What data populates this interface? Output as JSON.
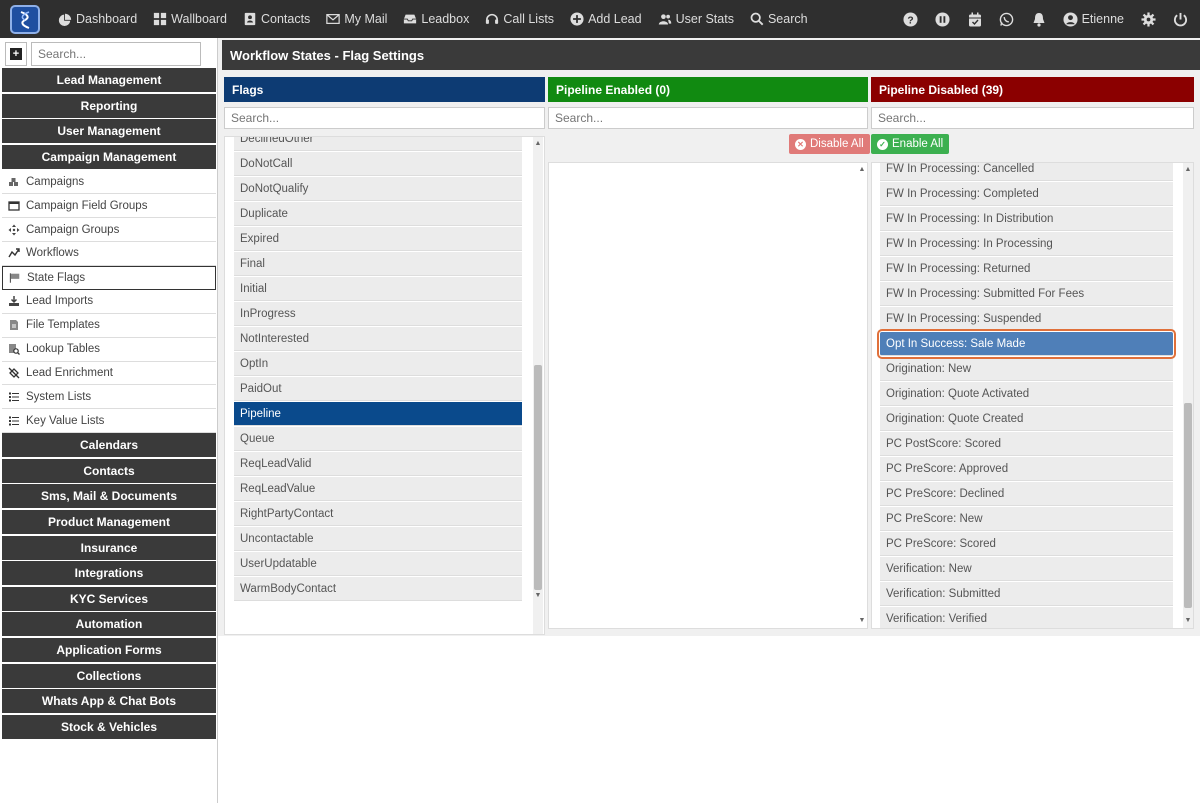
{
  "nav": {
    "items": [
      {
        "label": "Dashboard",
        "icon": "dashboard-icon"
      },
      {
        "label": "Wallboard",
        "icon": "grid-icon"
      },
      {
        "label": "Contacts",
        "icon": "contacts-icon"
      },
      {
        "label": "My Mail",
        "icon": "mail-icon"
      },
      {
        "label": "Leadbox",
        "icon": "inbox-icon"
      },
      {
        "label": "Call Lists",
        "icon": "headset-icon"
      },
      {
        "label": "Add Lead",
        "icon": "plus-circle-icon"
      },
      {
        "label": "User Stats",
        "icon": "users-icon"
      },
      {
        "label": "Search",
        "icon": "search-icon"
      }
    ],
    "user": "Etienne"
  },
  "sidebar": {
    "search_placeholder": "Search...",
    "sections_top": [
      "Lead Management",
      "Reporting",
      "User Management",
      "Campaign Management"
    ],
    "sub_items": [
      {
        "label": "Campaigns",
        "icon": "campaigns-icon"
      },
      {
        "label": "Campaign Field Groups",
        "icon": "window-icon"
      },
      {
        "label": "Campaign Groups",
        "icon": "cross-arrows-icon"
      },
      {
        "label": "Workflows",
        "icon": "workflow-icon"
      },
      {
        "label": "State Flags",
        "icon": "flag-icon"
      },
      {
        "label": "Lead Imports",
        "icon": "import-icon"
      },
      {
        "label": "File Templates",
        "icon": "file-icon"
      },
      {
        "label": "Lookup Tables",
        "icon": "lookup-icon"
      },
      {
        "label": "Lead Enrichment",
        "icon": "enrich-icon"
      },
      {
        "label": "System Lists",
        "icon": "list-icon"
      },
      {
        "label": "Key Value Lists",
        "icon": "list-icon"
      }
    ],
    "active_sub": "State Flags",
    "sections_bottom": [
      "Calendars",
      "Contacts",
      "Sms, Mail & Documents",
      "Product Management",
      "Insurance",
      "Integrations",
      "KYC Services",
      "Automation",
      "Application Forms",
      "Collections",
      "Whats App & Chat Bots",
      "Stock & Vehicles"
    ]
  },
  "page": {
    "title": "Workflow States - Flag Settings"
  },
  "flags": {
    "header": "Flags",
    "search_placeholder": "Search...",
    "partial_item": "DeclinedOther",
    "items": [
      "DoNotCall",
      "DoNotQualify",
      "Duplicate",
      "Expired",
      "Final",
      "Initial",
      "InProgress",
      "NotInterested",
      "OptIn",
      "PaidOut",
      "Pipeline",
      "Queue",
      "ReqLeadValid",
      "ReqLeadValue",
      "RightPartyContact",
      "Uncontactable",
      "UserUpdatable",
      "WarmBodyContact"
    ],
    "selected": "Pipeline"
  },
  "enabled": {
    "header": "Pipeline Enabled (0)",
    "search_placeholder": "Search...",
    "disable_all": "Disable All"
  },
  "disabled": {
    "header": "Pipeline Disabled (39)",
    "search_placeholder": "Search...",
    "enable_all": "Enable All",
    "items": [
      "FW In Processing: Cancelled",
      "FW In Processing: Completed",
      "FW In Processing: In Distribution",
      "FW In Processing: In Processing",
      "FW In Processing: Returned",
      "FW In Processing: Submitted For Fees",
      "FW In Processing: Suspended",
      "Opt In Success: Sale Made",
      "Origination: New",
      "Origination: Quote Activated",
      "Origination: Quote Created",
      "PC PostScore: Scored",
      "PC PreScore: Approved",
      "PC PreScore: Declined",
      "PC PreScore: New",
      "PC PreScore: Scored",
      "Verification: New",
      "Verification: Submitted",
      "Verification: Verified"
    ],
    "highlighted": "Opt In Success: Sale Made"
  },
  "colors": {
    "flags_header": "#0d3b73",
    "enabled_header": "#118a11",
    "disabled_header": "#8b0000",
    "selected": "#0a4a8c",
    "highlight": "#4f7fb8",
    "disable_btn": "#e07a78",
    "enable_btn": "#3cb050"
  }
}
